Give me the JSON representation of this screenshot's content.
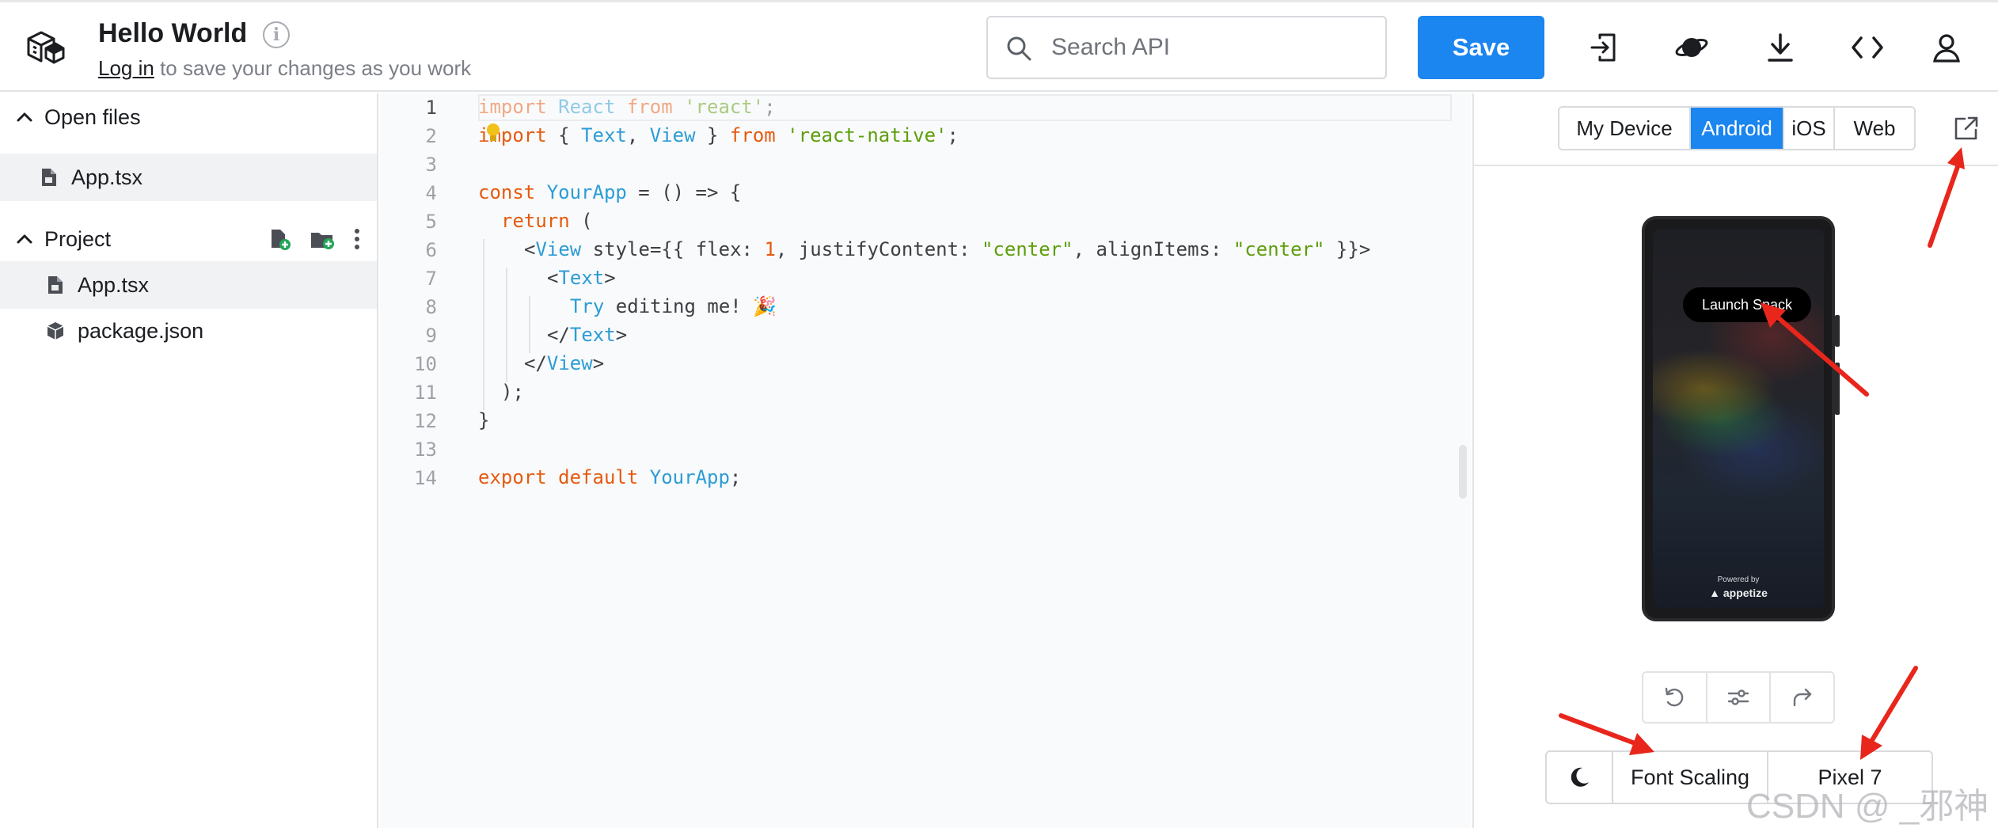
{
  "header": {
    "project_title": "Hello World",
    "login_link": "Log in",
    "login_suffix": " to save your changes as you work",
    "search_placeholder": "Search API",
    "save_label": "Save",
    "icons": [
      "logo-icon",
      "info-icon",
      "search-icon",
      "signin-icon",
      "planet-icon",
      "download-icon",
      "code-icon",
      "user-icon"
    ]
  },
  "sidebar": {
    "open_files_label": "Open files",
    "open_files": [
      "App.tsx"
    ],
    "project_label": "Project",
    "project_files": [
      {
        "name": "App.tsx",
        "icon": "file-icon"
      },
      {
        "name": "package.json",
        "icon": "package-icon"
      }
    ]
  },
  "editor": {
    "line_numbers": [
      "1",
      "2",
      "3",
      "4",
      "5",
      "6",
      "7",
      "8",
      "9",
      "10",
      "11",
      "12",
      "13",
      "14"
    ],
    "tokens": {
      "l1": [
        "import",
        " ",
        "React",
        " ",
        "from",
        " ",
        "'react'",
        ";"
      ],
      "l2": [
        "import",
        " { ",
        "Text",
        ", ",
        "View",
        " } ",
        "from",
        " ",
        "'react-native'",
        ";"
      ],
      "l4": [
        "const",
        " ",
        "YourApp",
        " = () => {"
      ],
      "l5": [
        "return",
        " ("
      ],
      "l6": [
        "<",
        "View",
        " style={{ flex: ",
        "1",
        ", justifyContent: ",
        "\"center\"",
        ", alignItems: ",
        "\"center\"",
        " }}>"
      ],
      "l7": [
        "<",
        "Text",
        ">"
      ],
      "l8": [
        "Try",
        " editing me! 🎉"
      ],
      "l9": [
        "</",
        "Text",
        ">"
      ],
      "l10": [
        "</",
        "View",
        ">"
      ],
      "l11": [
        ");"
      ],
      "l12": [
        "}"
      ],
      "l14": [
        "export",
        " ",
        "default",
        " ",
        "YourApp",
        ";"
      ]
    }
  },
  "preview": {
    "device_tabs": [
      "My Device",
      "Android",
      "iOS",
      "Web"
    ],
    "active_tab": "Android",
    "launch_button": "Launch Snack",
    "powered_by": "Powered by",
    "appetize": "appetize",
    "font_scaling": "Font Scaling",
    "device_model": "Pixel 7"
  },
  "watermark": "CSDN @ _邪神",
  "colors": {
    "accent": "#1b85f0",
    "keyword": "#e65a0f",
    "identifier": "#2c9cd5",
    "string": "#5d9e0b",
    "annotation_arrow": "#e8261c"
  }
}
